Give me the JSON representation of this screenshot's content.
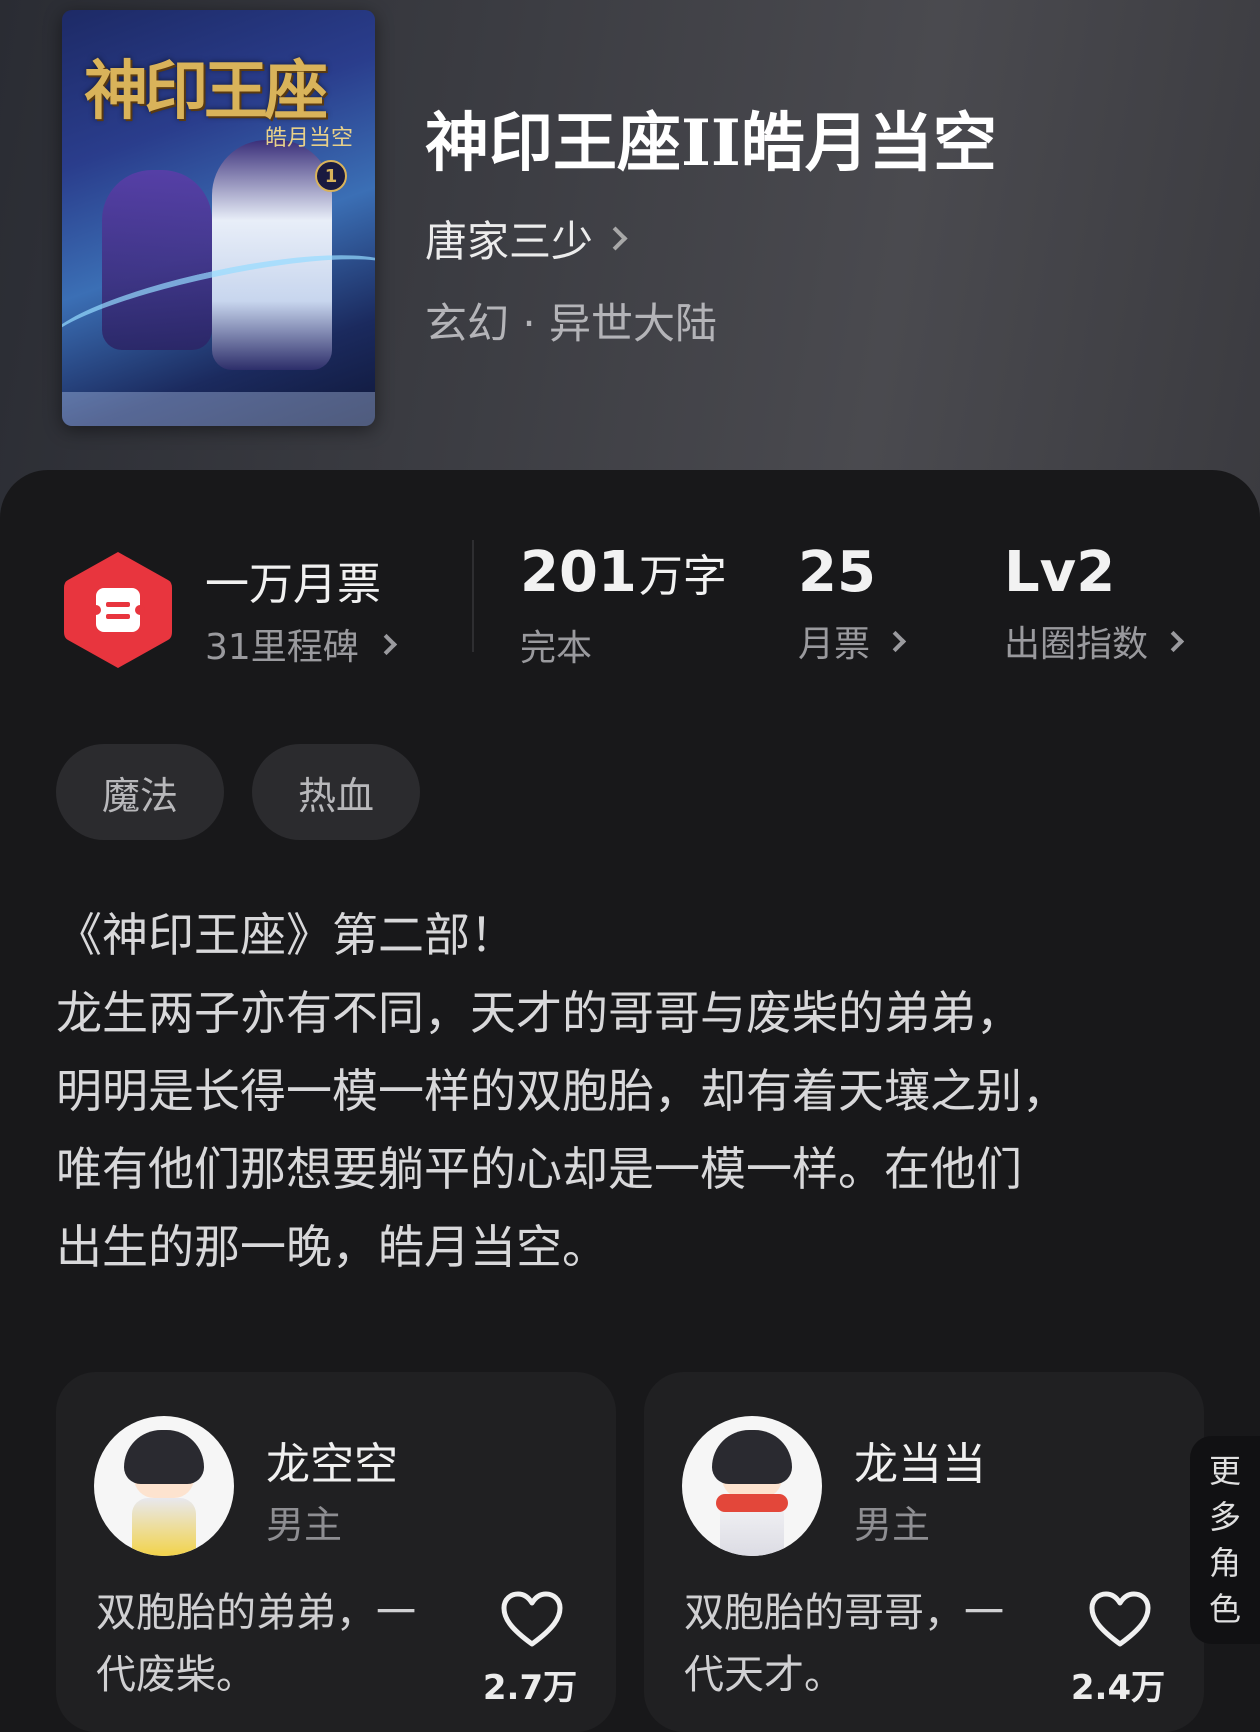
{
  "book": {
    "title": "神印王座II皓月当空",
    "author": "唐家三少",
    "genre": "玄幻 · 异世大陆",
    "cover_text": {
      "title": "神印王座",
      "subtitle": "皓月当空",
      "volume": "1"
    }
  },
  "stats": {
    "badge_title": "一万月票",
    "badge_sub": "31里程碑",
    "word_count_num": "201",
    "word_count_unit": "万字",
    "word_count_label": "完本",
    "monthly_votes_num": "25",
    "monthly_votes_label": "月票",
    "circle_index_num": "Lv2",
    "circle_index_label": "出圈指数"
  },
  "tags": [
    "魔法",
    "热血"
  ],
  "description": [
    "《神印王座》第二部！",
    "龙生两子亦有不同，天才的哥哥与废柴的弟弟，",
    "明明是长得一模一样的双胞胎，却有着天壤之别，",
    "唯有他们那想要躺平的心却是一模一样。在他们",
    "出生的那一晚，皓月当空。"
  ],
  "characters": [
    {
      "name": "龙空空",
      "role": "男主",
      "desc_line1": "双胞胎的弟弟，一",
      "desc_line2": "代废柴。",
      "likes": "2.7万"
    },
    {
      "name": "龙当当",
      "role": "男主",
      "desc_line1": "双胞胎的哥哥，一",
      "desc_line2": "代天才。",
      "likes": "2.4万"
    }
  ],
  "more_roles": [
    "更",
    "多",
    "角",
    "色"
  ],
  "colors": {
    "badge_red": "#e8353e",
    "panel_bg": "#18181a",
    "card_bg": "#202022",
    "tag_bg": "#2b2b2e"
  },
  "icons": {
    "badge": "ticket-hexagon-icon",
    "chevron": "chevron-right-icon",
    "like": "heart-outline-icon"
  }
}
